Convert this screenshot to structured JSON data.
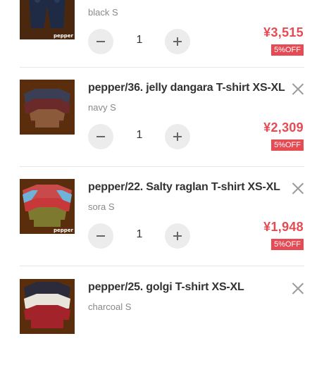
{
  "accent_color": "#e64a53",
  "cart": {
    "items": [
      {
        "name": "",
        "variant": "black S",
        "quantity": "1",
        "price": "¥3,515",
        "discount": "5%OFF",
        "thumb_label": "pepper",
        "remove_icon": "close-icon"
      },
      {
        "name": "pepper/36. jelly dangara T-shirt XS-XL",
        "variant": "navy S",
        "quantity": "1",
        "price": "¥2,309",
        "discount": "5%OFF",
        "thumb_label": "",
        "remove_icon": "close-icon"
      },
      {
        "name": "pepper/22. Salty raglan T-shirt XS-XL",
        "variant": "sora S",
        "quantity": "1",
        "price": "¥1,948",
        "discount": "5%OFF",
        "thumb_label": "pepper",
        "remove_icon": "close-icon"
      },
      {
        "name": "pepper/25. golgi T-shirt XS-XL",
        "variant": "charcoal S",
        "quantity": "",
        "price": "",
        "discount": "",
        "thumb_label": "",
        "remove_icon": "close-icon"
      }
    ]
  }
}
